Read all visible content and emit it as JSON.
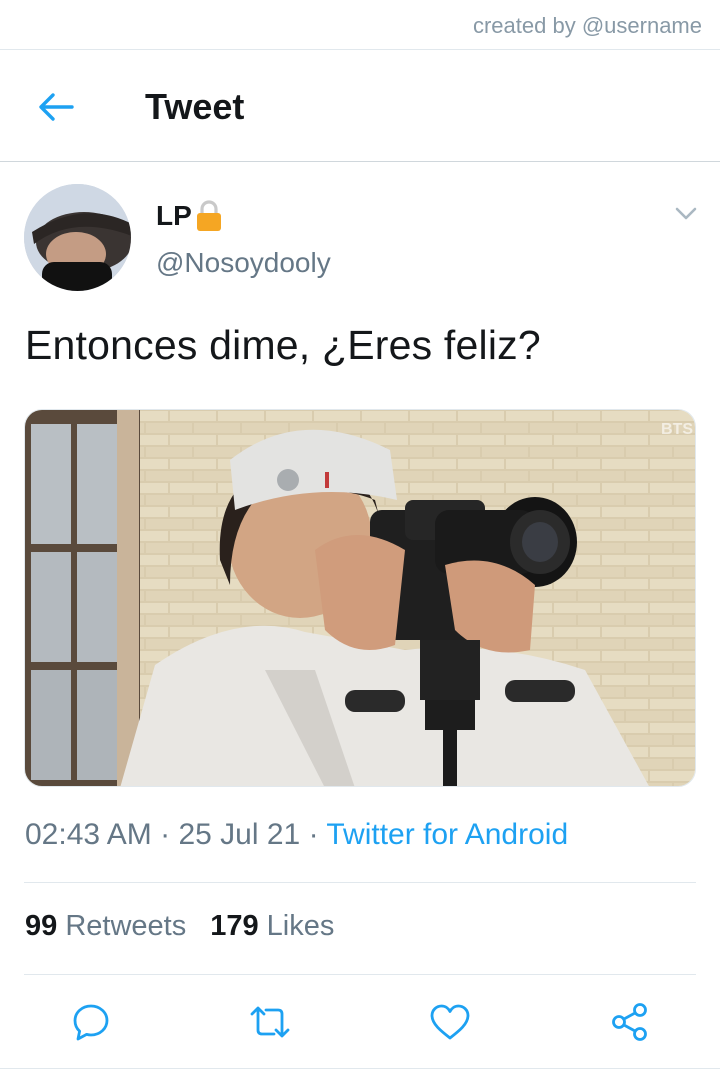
{
  "watermark": "created by @username",
  "header": {
    "title": "Tweet",
    "back_icon": "arrow-left-icon"
  },
  "tweet": {
    "display_name": "LP",
    "lock_icon": "lock-icon",
    "handle": "@Nosoydooly",
    "text": "Entonces dime, ¿Eres feliz?",
    "time": "02:43 AM",
    "separator": "·",
    "date": "25 Jul 21",
    "source": "Twitter for Android",
    "media_overlay_text": "BTS"
  },
  "stats": {
    "retweets_count": "99",
    "retweets_label": "Retweets",
    "likes_count": "179",
    "likes_label": "Likes"
  },
  "actions": [
    "reply-icon",
    "retweet-icon",
    "like-icon",
    "share-icon"
  ],
  "colors": {
    "accent": "#1da1f2",
    "secondary_text": "#657786",
    "primary_text": "#14171a",
    "lock": "#f5a623"
  }
}
